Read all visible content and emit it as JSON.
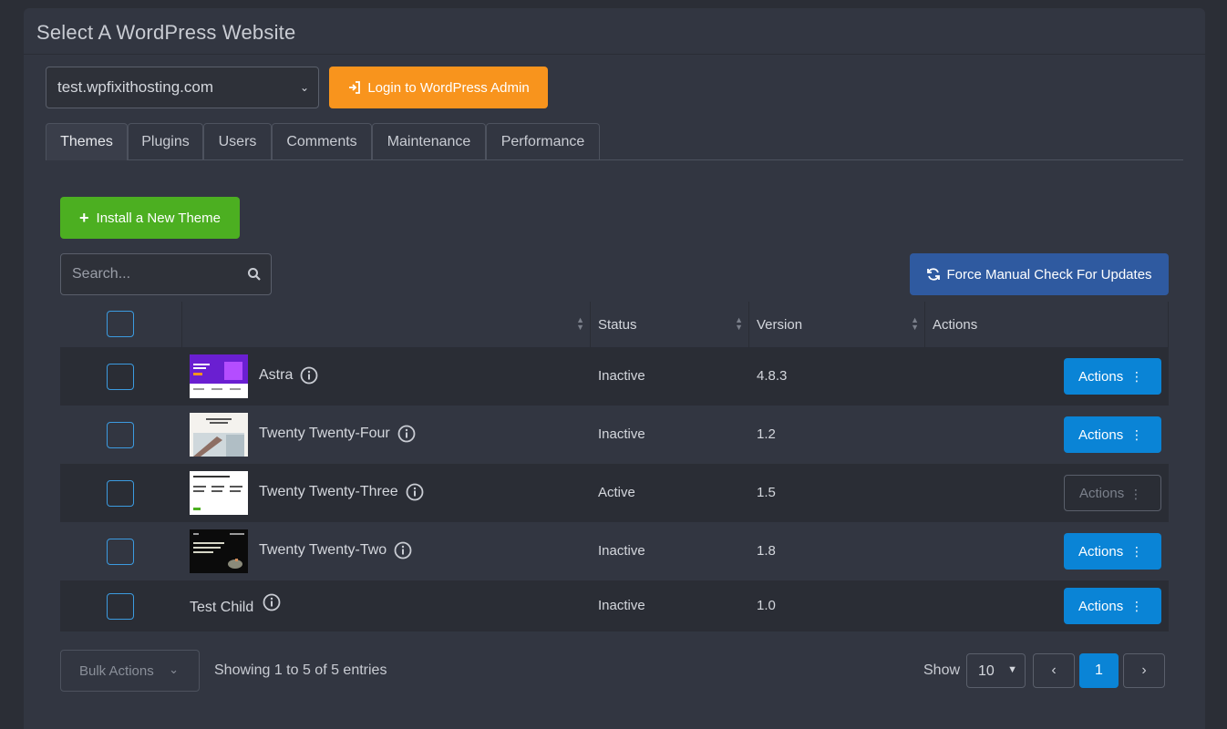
{
  "panel": {
    "title": "Select A WordPress Website"
  },
  "site_select": {
    "value": "test.wpfixithosting.com"
  },
  "login_button": {
    "label": "Login to WordPress Admin",
    "color": "#f8941d"
  },
  "tabs": [
    {
      "label": "Themes",
      "active": true
    },
    {
      "label": "Plugins"
    },
    {
      "label": "Users"
    },
    {
      "label": "Comments"
    },
    {
      "label": "Maintenance"
    },
    {
      "label": "Performance"
    }
  ],
  "install_button": {
    "label": "Install a New Theme",
    "color": "#4caf21"
  },
  "search": {
    "placeholder": "Search..."
  },
  "force_button": {
    "label": "Force Manual Check For Updates",
    "color": "#2f5aa0"
  },
  "table": {
    "columns": {
      "status": "Status",
      "version": "Version",
      "actions": "Actions"
    },
    "rows": [
      {
        "name": "Astra",
        "status": "Inactive",
        "version": "4.8.3",
        "action": "Actions",
        "thumb": "astra"
      },
      {
        "name": "Twenty Twenty-Four",
        "status": "Inactive",
        "version": "1.2",
        "action": "Actions",
        "thumb": "tt4"
      },
      {
        "name": "Twenty Twenty-Three",
        "status": "Active",
        "version": "1.5",
        "action": "Actions",
        "thumb": "tt3"
      },
      {
        "name": "Twenty Twenty-Two",
        "status": "Inactive",
        "version": "1.8",
        "action": "Actions",
        "thumb": "tt2"
      },
      {
        "name": "Test Child",
        "status": "Inactive",
        "version": "1.0",
        "action": "Actions",
        "thumb": ""
      }
    ]
  },
  "footer": {
    "bulk_actions": "Bulk Actions",
    "showing": "Showing 1 to 5 of 5 entries",
    "show_label": "Show",
    "page_length": "10",
    "current_page": "1"
  },
  "colors": {
    "primary": "#0a84d6",
    "checkbox_border": "#3c9be0"
  }
}
